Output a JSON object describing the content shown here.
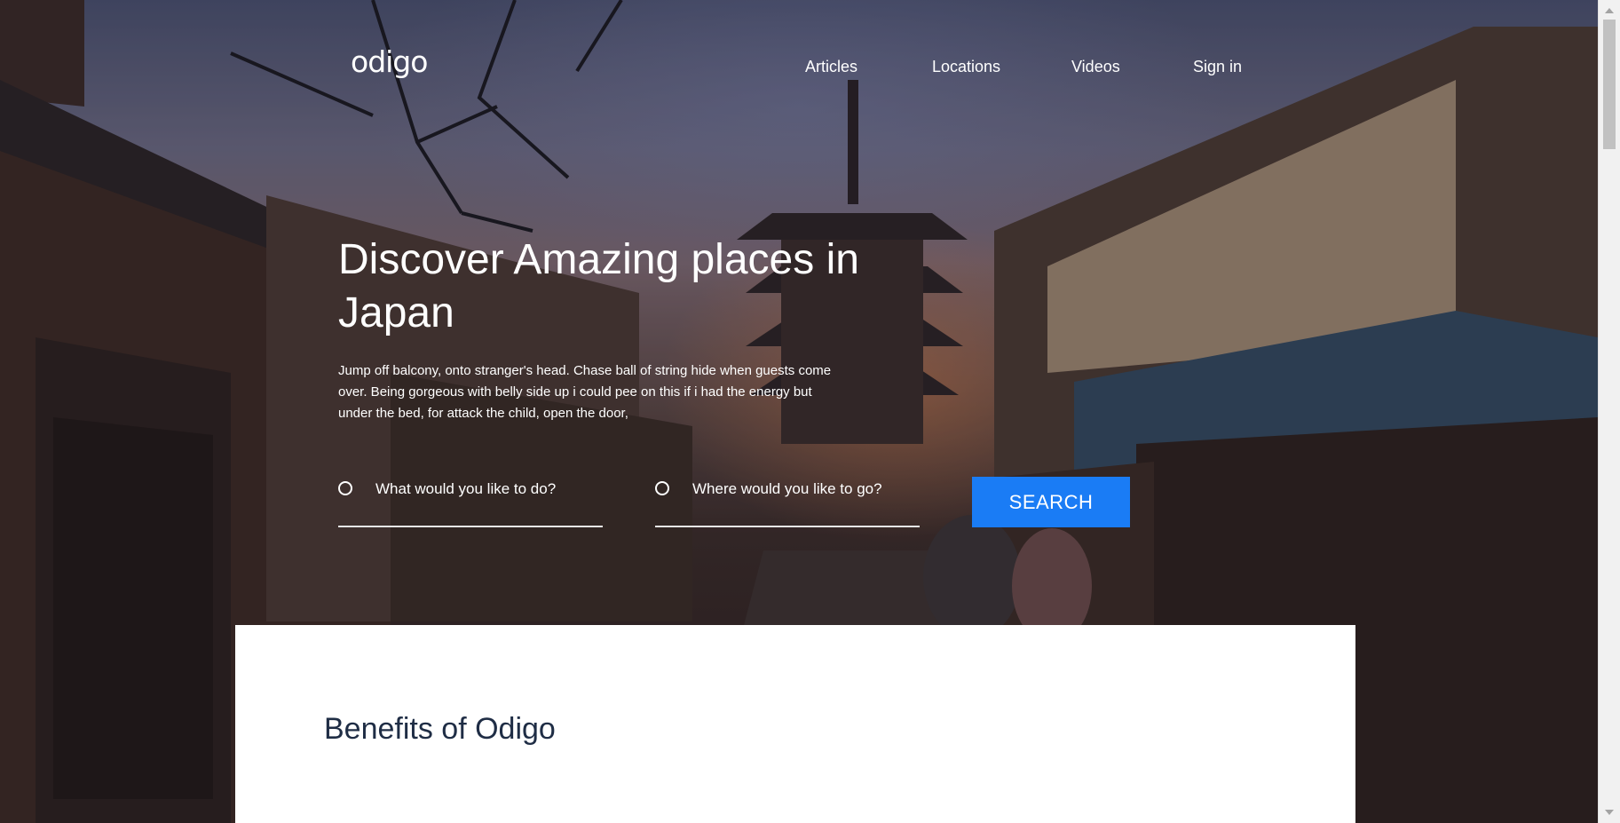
{
  "brand": {
    "logo": "odigo"
  },
  "nav": {
    "items": [
      {
        "label": "Articles"
      },
      {
        "label": "Locations"
      },
      {
        "label": "Videos"
      },
      {
        "label": "Sign in"
      }
    ]
  },
  "hero": {
    "title": "Discover Amazing places in Japan",
    "description": "Jump off balcony, onto stranger's head. Chase ball of string hide when guests come over. Being gorgeous with belly side up i could pee on this if i had the energy but under the bed, for attack the child, open the door,",
    "search": {
      "activity_placeholder": "What would you like to do?",
      "location_placeholder": "Where would you like to go?",
      "button_label": "SEARCH"
    }
  },
  "benefits": {
    "title": "Benefits of Odigo"
  },
  "colors": {
    "accent": "#1a7cf5",
    "title_text": "#1f2d45"
  }
}
